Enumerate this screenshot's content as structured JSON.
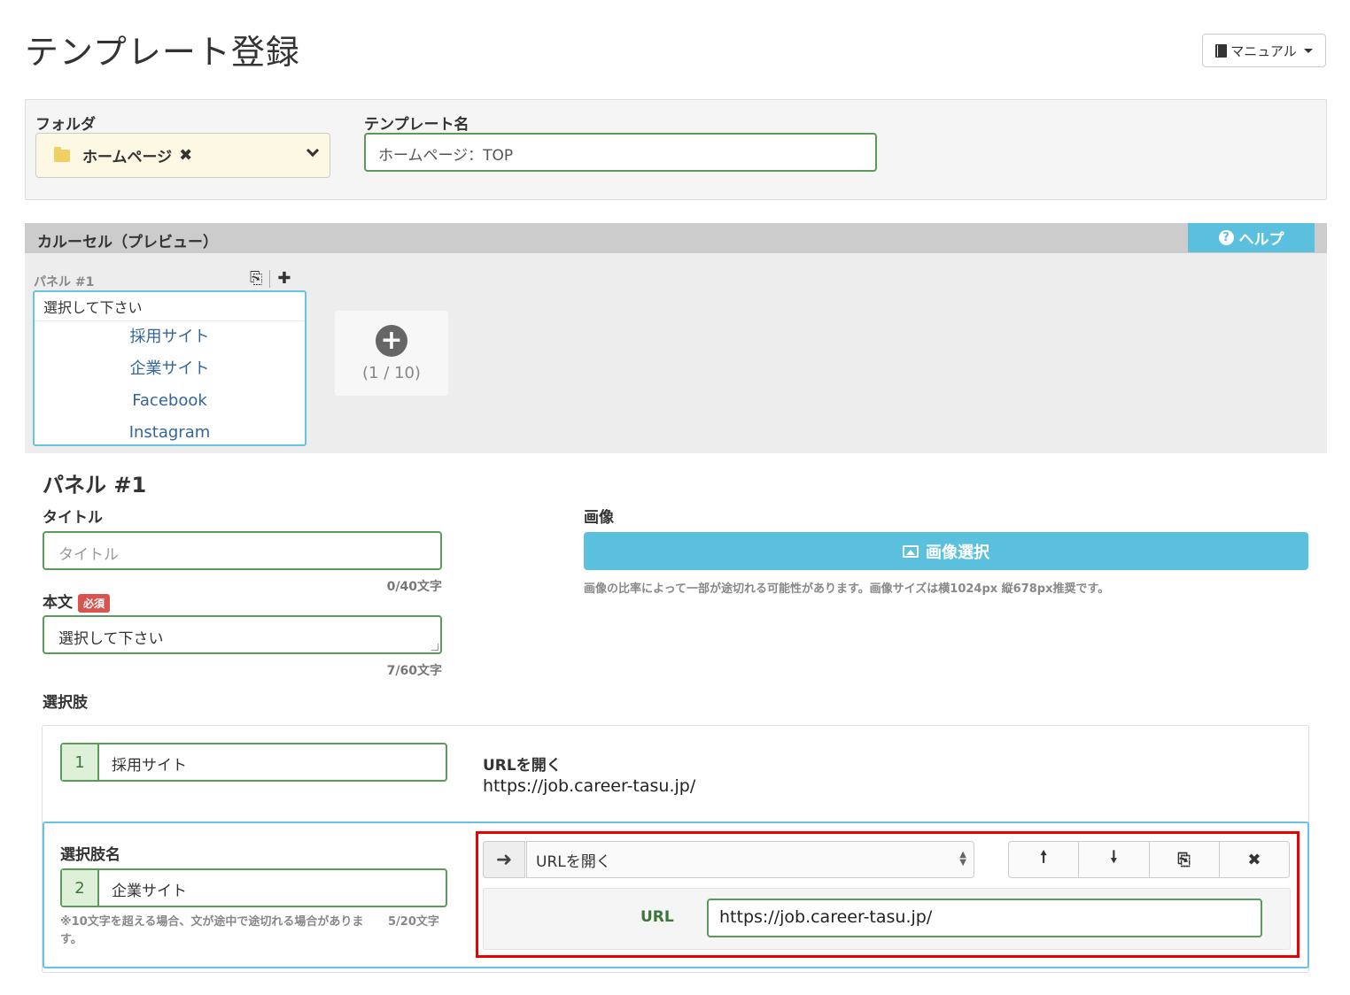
{
  "header": {
    "title": "テンプレート登録",
    "manual_label": "マニュアル"
  },
  "folder": {
    "label": "フォルダ",
    "value": "ホームページ"
  },
  "template": {
    "label": "テンプレート名",
    "value": "ホームページ：TOP"
  },
  "carousel": {
    "title": "カルーセル（プレビュー）",
    "help_label": "ヘルプ",
    "panel_label": "パネル #1",
    "panel_prompt": "選択して下さい",
    "options": [
      "採用サイト",
      "企業サイト",
      "Facebook",
      "Instagram"
    ],
    "count": "(1 / 10)"
  },
  "panel": {
    "heading": "パネル #1",
    "title_label": "タイトル",
    "title_placeholder": "タイトル",
    "title_counter": "0/40文字",
    "body_label": "本文",
    "required_badge": "必須",
    "body_value": "選択して下さい",
    "body_counter": "7/60文字",
    "image_label": "画像",
    "image_button": "画像選択",
    "image_note": "画像の比率によって一部が途切れる可能性があります。画像サイズは横1024px 縦678px推奨です。",
    "choices_label": "選択肢"
  },
  "choices": [
    {
      "num": "1",
      "name": "採用サイト",
      "action": "URLを開く",
      "url": "https://job.career-tasu.jp/"
    },
    {
      "num": "2",
      "name": "企業サイト",
      "action": "URLを開く",
      "url": "https://job.career-tasu.jp/"
    }
  ],
  "choice_edit": {
    "name_label": "選択肢名",
    "note": "※10文字を超える場合、文が途中で途切れる場合があります。",
    "counter": "5/20文字",
    "url_label": "URL"
  }
}
